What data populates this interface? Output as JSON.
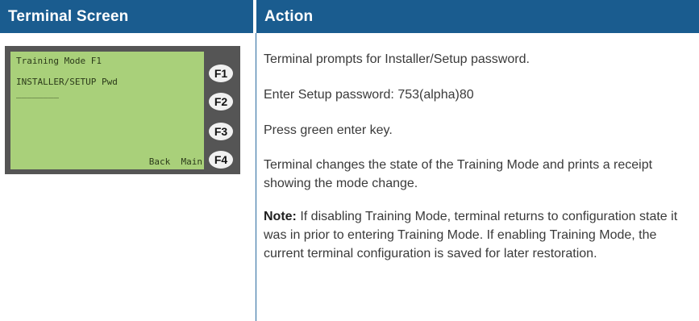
{
  "table": {
    "header_left": "Terminal Screen",
    "header_right": "Action"
  },
  "terminal": {
    "line1": "Training Mode F1",
    "line2": "INSTALLER/SETUP Pwd",
    "line3": "________",
    "softkeys": "Back  Main",
    "fkeys": [
      "F1",
      "F2",
      "F3",
      "F4"
    ],
    "colors": {
      "bezel": "#555555",
      "lcd": "#a9d07a",
      "header": "#1a5c8f"
    }
  },
  "actions": {
    "step1": "Terminal prompts for Installer/Setup password.",
    "step2": "Enter Setup password: 753(alpha)80",
    "step3": "Press green enter key.",
    "step4": "Terminal changes the state of the Training Mode and prints a receipt showing the mode change.",
    "note_label": "Note:",
    "note_text": " If disabling Training Mode, terminal returns to configuration state it was in prior to entering Training Mode. If enabling Training Mode, the current terminal configuration is saved for later restoration."
  }
}
